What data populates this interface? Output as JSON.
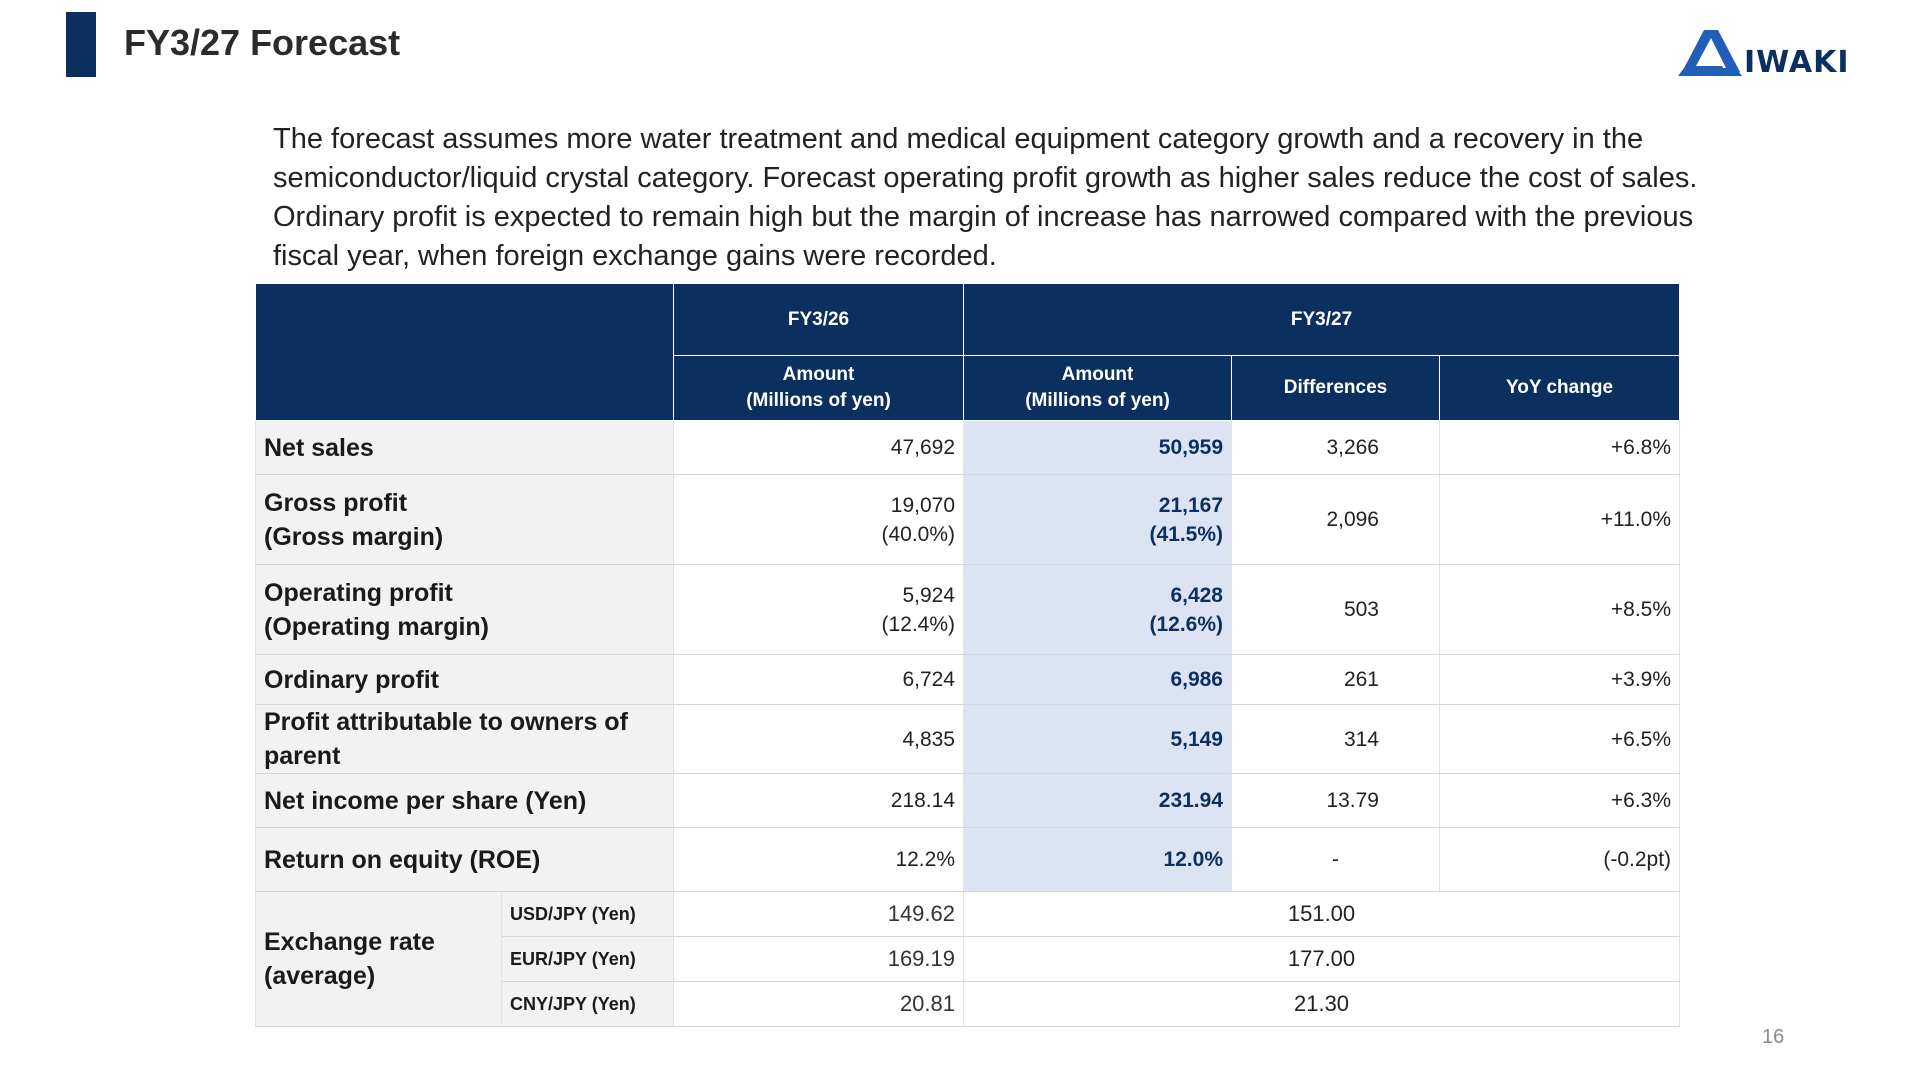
{
  "title": "FY3/27 Forecast",
  "logo_text": "IWAKI",
  "page_number": "16",
  "colors": {
    "primary": "#0b2f5e",
    "highlight": "#dce4f3",
    "label_bg": "#f2f2f2"
  },
  "description": "The forecast assumes more water treatment and medical equipment category growth and a recovery in the semiconductor/liquid crystal category. Forecast operating profit growth as higher sales reduce the cost of sales. Ordinary profit is expected to remain high but the margin of increase has narrowed compared with the previous fiscal year, when foreign exchange gains were recorded.",
  "table": {
    "header": {
      "fy26": "FY3/26",
      "fy27": "FY3/27",
      "amount1": "Amount",
      "amount1_unit": "(Millions of yen)",
      "amount2": "Amount",
      "amount2_unit": "(Millions of yen)",
      "differences": "Differences",
      "yoy": "YoY change"
    },
    "rows": [
      {
        "label1": "Net sales",
        "label2": "",
        "fy26": "47,692",
        "fy26_sub": "",
        "fy27": "50,959",
        "fy27_sub": "",
        "diff": "3,266",
        "yoy": "+6.8%"
      },
      {
        "label1": "Gross profit",
        "label2": "(Gross margin)",
        "fy26": "19,070",
        "fy26_sub": "(40.0%)",
        "fy27": "21,167",
        "fy27_sub": "(41.5%)",
        "diff": "2,096",
        "yoy": "+11.0%"
      },
      {
        "label1": "Operating profit",
        "label2": "(Operating margin)",
        "fy26": "5,924",
        "fy26_sub": "(12.4%)",
        "fy27": "6,428",
        "fy27_sub": "(12.6%)",
        "diff": "503",
        "yoy": "+8.5%"
      },
      {
        "label1": "Ordinary profit",
        "label2": "",
        "fy26": "6,724",
        "fy26_sub": "",
        "fy27": "6,986",
        "fy27_sub": "",
        "diff": "261",
        "yoy": "+3.9%"
      },
      {
        "label1": "Profit attributable to owners of",
        "label2": "parent",
        "fy26": "4,835",
        "fy26_sub": "",
        "fy27": "5,149",
        "fy27_sub": "",
        "diff": "314",
        "yoy": "+6.5%"
      },
      {
        "label1": "Net income per share (Yen)",
        "label2": "",
        "fy26": "218.14",
        "fy26_sub": "",
        "fy27": "231.94",
        "fy27_sub": "",
        "diff": "13.79",
        "yoy": "+6.3%"
      },
      {
        "label1": "Return on equity (ROE)",
        "label2": "",
        "fy26": "12.2%",
        "fy26_sub": "",
        "fy27": "12.0%",
        "fy27_sub": "",
        "diff": "-",
        "yoy": "(-0.2pt)"
      }
    ],
    "fx": {
      "label1": "Exchange rate",
      "label2": "(average)",
      "rows": [
        {
          "pair": "USD/JPY (Yen)",
          "fy26": "149.62",
          "fy27": "151.00"
        },
        {
          "pair": "EUR/JPY (Yen)",
          "fy26": "169.19",
          "fy27": "177.00"
        },
        {
          "pair": "CNY/JPY (Yen)",
          "fy26": "20.81",
          "fy27": "21.30"
        }
      ]
    }
  }
}
